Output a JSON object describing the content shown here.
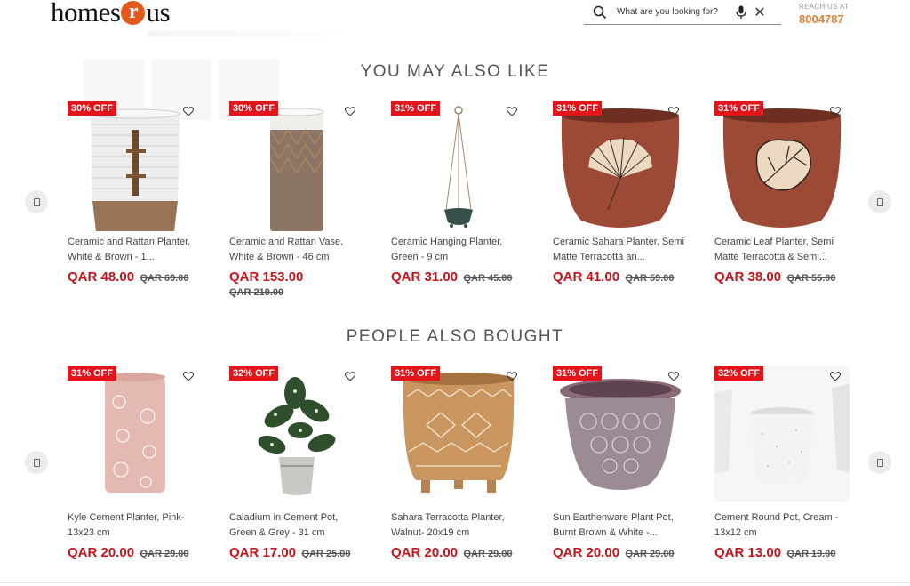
{
  "header": {
    "logo_left": "homes",
    "logo_mid": "r",
    "logo_right": "us",
    "search_placeholder": "What are you looking for?",
    "reach_label": "REACH US AT",
    "reach_number": "8004787"
  },
  "colors": {
    "accent": "#e2591b",
    "price": "#c4141b",
    "badge": "#e4141b"
  },
  "sections": [
    {
      "title": "YOU MAY ALSO LIKE",
      "products": [
        {
          "badge": "30% OFF",
          "name": "Ceramic and Rattan Planter, White & Brown - 1...",
          "price": "QAR 48.00",
          "old_price": "QAR 69.00"
        },
        {
          "badge": "30% OFF",
          "name": "Ceramic and Rattan Vase, White & Brown - 46 cm",
          "price": "QAR 153.00",
          "old_price": "QAR 219.00"
        },
        {
          "badge": "31% OFF",
          "name": "Ceramic Hanging Planter, Green - 9 cm",
          "price": "QAR 31.00",
          "old_price": "QAR 45.00"
        },
        {
          "badge": "31% OFF",
          "name": "Ceramic Sahara Planter, Semi Matte Terracotta an...",
          "price": "QAR 41.00",
          "old_price": "QAR 59.00"
        },
        {
          "badge": "31% OFF",
          "name": "Ceramic Leaf Planter, Semi Matte Terracotta & Semi...",
          "price": "QAR 38.00",
          "old_price": "QAR 55.00"
        }
      ]
    },
    {
      "title": "PEOPLE ALSO BOUGHT",
      "products": [
        {
          "badge": "31% OFF",
          "name": "Kyle Cement Planter, Pink- 13x23 cm",
          "price": "QAR 20.00",
          "old_price": "QAR 29.00"
        },
        {
          "badge": "32% OFF",
          "name": "Caladium in Cement Pot, Green & Grey - 31 cm",
          "price": "QAR 17.00",
          "old_price": "QAR 25.00"
        },
        {
          "badge": "31% OFF",
          "name": "Sahara Terracotta Planter, Walnut- 20x19 cm",
          "price": "QAR 20.00",
          "old_price": "QAR 29.00"
        },
        {
          "badge": "31% OFF",
          "name": "Sun Earthenware Plant Pot, Burnt Brown & White -...",
          "price": "QAR 20.00",
          "old_price": "QAR 29.00"
        },
        {
          "badge": "32% OFF",
          "name": "Cement Round Pot, Cream - 13x12 cm",
          "price": "QAR 13.00",
          "old_price": "QAR 19.00"
        }
      ]
    }
  ]
}
